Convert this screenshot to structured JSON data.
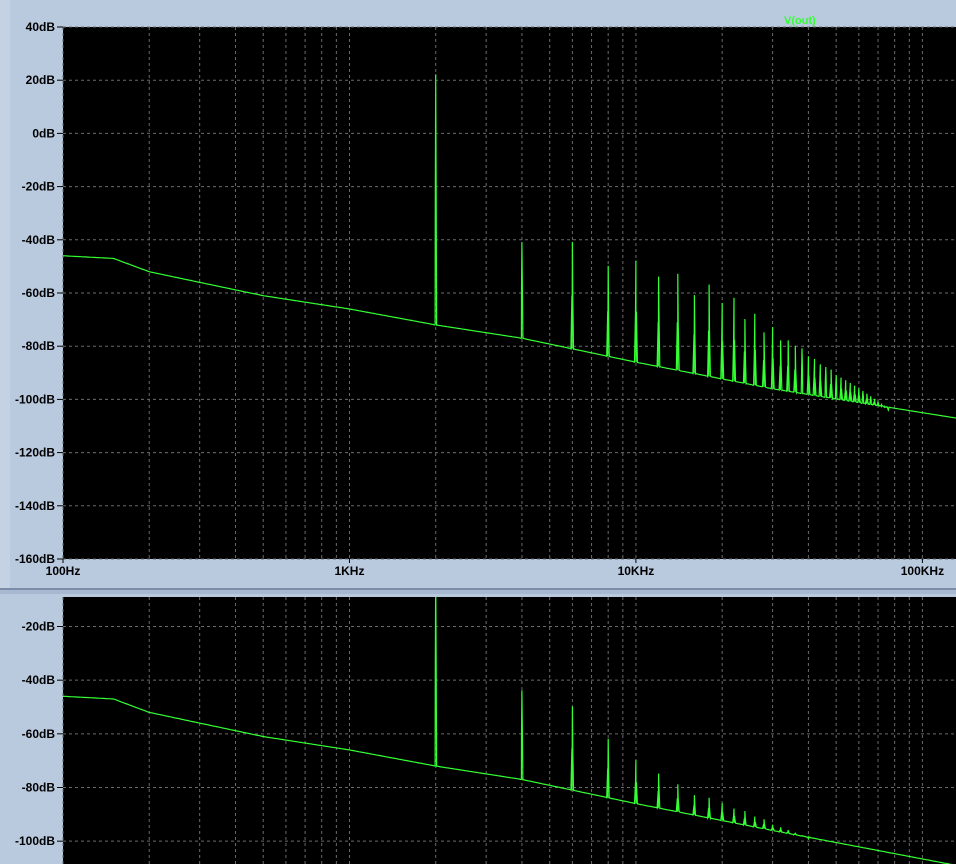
{
  "trace_label": "V(out)",
  "colors": {
    "trace": "#33ff33",
    "plot_bg": "#000000",
    "grid": "#6b6b6b",
    "frame": "#b9c9de"
  },
  "x_tick_labels": [
    "100Hz",
    "1KHz",
    "10KHz",
    "100KHz"
  ],
  "chart_data": [
    {
      "type": "line",
      "title": "",
      "xlabel": "",
      "ylabel": "",
      "x_scale": "log",
      "xlim": [
        100,
        131000
      ],
      "ylim": [
        -160,
        40
      ],
      "grid": true,
      "y_tick_labels": [
        "40dB",
        "20dB",
        "0dB",
        "-20dB",
        "-40dB",
        "-60dB",
        "-80dB",
        "-100dB",
        "-120dB",
        "-140dB",
        "-160dB"
      ],
      "y_ticks": [
        40,
        20,
        0,
        -20,
        -40,
        -60,
        -80,
        -100,
        -120,
        -140,
        -160
      ],
      "x_tick_labels": [
        "100Hz",
        "1KHz",
        "10KHz",
        "100KHz"
      ],
      "x_ticks": [
        100,
        1000,
        10000,
        100000
      ],
      "series": [
        {
          "name": "V(out)",
          "baseline": [
            [
              100,
              -46
            ],
            [
              150,
              -47
            ],
            [
              200,
              -52
            ],
            [
              300,
              -56
            ],
            [
              500,
              -61
            ],
            [
              1000,
              -66
            ],
            [
              2000,
              -72
            ],
            [
              4000,
              -77
            ],
            [
              10000,
              -86
            ],
            [
              30000,
              -96
            ],
            [
              131000,
              -107
            ]
          ],
          "peaks": [
            [
              2000,
              22
            ],
            [
              4000,
              -41
            ],
            [
              6000,
              -41
            ],
            [
              8000,
              -50
            ],
            [
              10000,
              -48
            ],
            [
              12000,
              -54
            ],
            [
              14000,
              -53
            ],
            [
              16000,
              -61
            ],
            [
              18000,
              -57
            ],
            [
              20000,
              -64
            ],
            [
              22000,
              -62
            ],
            [
              24000,
              -70
            ],
            [
              26000,
              -68
            ],
            [
              28000,
              -75
            ],
            [
              30000,
              -73
            ],
            [
              32000,
              -78
            ],
            [
              34000,
              -78
            ],
            [
              36000,
              -80
            ],
            [
              38000,
              -81
            ],
            [
              40000,
              -84
            ],
            [
              42000,
              -85
            ],
            [
              44000,
              -87
            ],
            [
              46000,
              -88
            ],
            [
              48000,
              -89
            ],
            [
              50000,
              -91
            ],
            [
              52000,
              -92
            ],
            [
              54000,
              -93
            ],
            [
              56000,
              -94
            ],
            [
              58000,
              -95
            ],
            [
              60000,
              -96
            ],
            [
              62000,
              -97
            ],
            [
              64000,
              -98
            ],
            [
              66000,
              -99
            ],
            [
              68000,
              -100
            ],
            [
              70000,
              -101
            ],
            [
              72000,
              -102
            ],
            [
              74000,
              -103
            ],
            [
              76000,
              -104
            ]
          ]
        }
      ]
    },
    {
      "type": "line",
      "title": "",
      "xlabel": "",
      "ylabel": "",
      "x_scale": "log",
      "xlim": [
        100,
        131000
      ],
      "ylim": [
        -110,
        -9
      ],
      "grid": true,
      "y_tick_labels": [
        "-20dB",
        "-40dB",
        "-60dB",
        "-80dB",
        "-100dB"
      ],
      "y_ticks": [
        -20,
        -40,
        -60,
        -80,
        -100
      ],
      "series": [
        {
          "name": "V(out)",
          "baseline": [
            [
              100,
              -46
            ],
            [
              150,
              -47
            ],
            [
              200,
              -52
            ],
            [
              300,
              -56
            ],
            [
              500,
              -61
            ],
            [
              1000,
              -66
            ],
            [
              2000,
              -72
            ],
            [
              4000,
              -77
            ],
            [
              10000,
              -86
            ],
            [
              30000,
              -96
            ],
            [
              131000,
              -109
            ]
          ],
          "peaks": [
            [
              2000,
              0
            ],
            [
              4000,
              -44
            ],
            [
              6000,
              -50
            ],
            [
              8000,
              -62
            ],
            [
              10000,
              -70
            ],
            [
              12000,
              -75
            ],
            [
              14000,
              -79
            ],
            [
              16000,
              -83
            ],
            [
              18000,
              -84
            ],
            [
              20000,
              -86
            ],
            [
              22000,
              -88
            ],
            [
              24000,
              -89
            ],
            [
              26000,
              -91
            ],
            [
              28000,
              -92
            ],
            [
              30000,
              -94
            ],
            [
              32000,
              -95
            ],
            [
              34000,
              -96
            ],
            [
              36000,
              -97
            ],
            [
              38000,
              -98
            ],
            [
              40000,
              -99
            ]
          ]
        }
      ]
    }
  ]
}
